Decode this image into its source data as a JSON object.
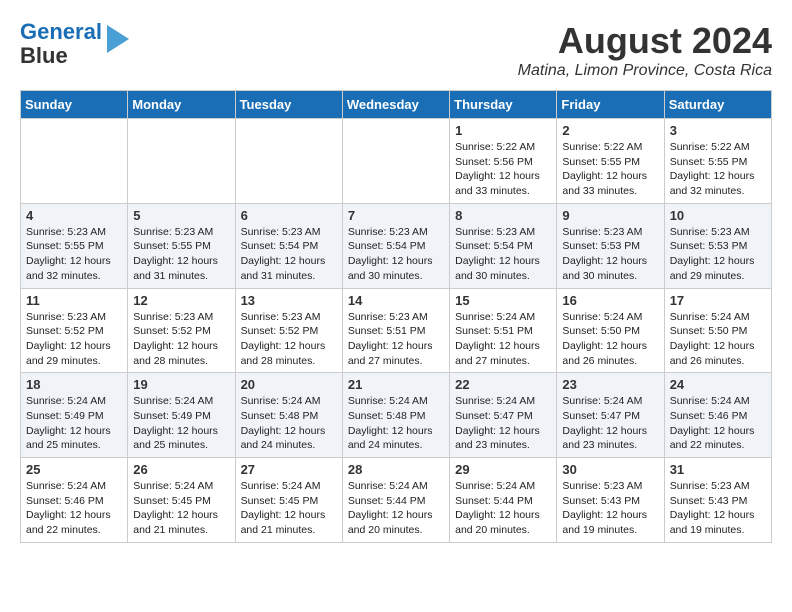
{
  "header": {
    "logo_line1": "General",
    "logo_line2": "Blue",
    "month_year": "August 2024",
    "location": "Matina, Limon Province, Costa Rica"
  },
  "weekdays": [
    "Sunday",
    "Monday",
    "Tuesday",
    "Wednesday",
    "Thursday",
    "Friday",
    "Saturday"
  ],
  "weeks": [
    [
      {
        "day": "",
        "text": ""
      },
      {
        "day": "",
        "text": ""
      },
      {
        "day": "",
        "text": ""
      },
      {
        "day": "",
        "text": ""
      },
      {
        "day": "1",
        "text": "Sunrise: 5:22 AM\nSunset: 5:56 PM\nDaylight: 12 hours\nand 33 minutes."
      },
      {
        "day": "2",
        "text": "Sunrise: 5:22 AM\nSunset: 5:55 PM\nDaylight: 12 hours\nand 33 minutes."
      },
      {
        "day": "3",
        "text": "Sunrise: 5:22 AM\nSunset: 5:55 PM\nDaylight: 12 hours\nand 32 minutes."
      }
    ],
    [
      {
        "day": "4",
        "text": "Sunrise: 5:23 AM\nSunset: 5:55 PM\nDaylight: 12 hours\nand 32 minutes."
      },
      {
        "day": "5",
        "text": "Sunrise: 5:23 AM\nSunset: 5:55 PM\nDaylight: 12 hours\nand 31 minutes."
      },
      {
        "day": "6",
        "text": "Sunrise: 5:23 AM\nSunset: 5:54 PM\nDaylight: 12 hours\nand 31 minutes."
      },
      {
        "day": "7",
        "text": "Sunrise: 5:23 AM\nSunset: 5:54 PM\nDaylight: 12 hours\nand 30 minutes."
      },
      {
        "day": "8",
        "text": "Sunrise: 5:23 AM\nSunset: 5:54 PM\nDaylight: 12 hours\nand 30 minutes."
      },
      {
        "day": "9",
        "text": "Sunrise: 5:23 AM\nSunset: 5:53 PM\nDaylight: 12 hours\nand 30 minutes."
      },
      {
        "day": "10",
        "text": "Sunrise: 5:23 AM\nSunset: 5:53 PM\nDaylight: 12 hours\nand 29 minutes."
      }
    ],
    [
      {
        "day": "11",
        "text": "Sunrise: 5:23 AM\nSunset: 5:52 PM\nDaylight: 12 hours\nand 29 minutes."
      },
      {
        "day": "12",
        "text": "Sunrise: 5:23 AM\nSunset: 5:52 PM\nDaylight: 12 hours\nand 28 minutes."
      },
      {
        "day": "13",
        "text": "Sunrise: 5:23 AM\nSunset: 5:52 PM\nDaylight: 12 hours\nand 28 minutes."
      },
      {
        "day": "14",
        "text": "Sunrise: 5:23 AM\nSunset: 5:51 PM\nDaylight: 12 hours\nand 27 minutes."
      },
      {
        "day": "15",
        "text": "Sunrise: 5:24 AM\nSunset: 5:51 PM\nDaylight: 12 hours\nand 27 minutes."
      },
      {
        "day": "16",
        "text": "Sunrise: 5:24 AM\nSunset: 5:50 PM\nDaylight: 12 hours\nand 26 minutes."
      },
      {
        "day": "17",
        "text": "Sunrise: 5:24 AM\nSunset: 5:50 PM\nDaylight: 12 hours\nand 26 minutes."
      }
    ],
    [
      {
        "day": "18",
        "text": "Sunrise: 5:24 AM\nSunset: 5:49 PM\nDaylight: 12 hours\nand 25 minutes."
      },
      {
        "day": "19",
        "text": "Sunrise: 5:24 AM\nSunset: 5:49 PM\nDaylight: 12 hours\nand 25 minutes."
      },
      {
        "day": "20",
        "text": "Sunrise: 5:24 AM\nSunset: 5:48 PM\nDaylight: 12 hours\nand 24 minutes."
      },
      {
        "day": "21",
        "text": "Sunrise: 5:24 AM\nSunset: 5:48 PM\nDaylight: 12 hours\nand 24 minutes."
      },
      {
        "day": "22",
        "text": "Sunrise: 5:24 AM\nSunset: 5:47 PM\nDaylight: 12 hours\nand 23 minutes."
      },
      {
        "day": "23",
        "text": "Sunrise: 5:24 AM\nSunset: 5:47 PM\nDaylight: 12 hours\nand 23 minutes."
      },
      {
        "day": "24",
        "text": "Sunrise: 5:24 AM\nSunset: 5:46 PM\nDaylight: 12 hours\nand 22 minutes."
      }
    ],
    [
      {
        "day": "25",
        "text": "Sunrise: 5:24 AM\nSunset: 5:46 PM\nDaylight: 12 hours\nand 22 minutes."
      },
      {
        "day": "26",
        "text": "Sunrise: 5:24 AM\nSunset: 5:45 PM\nDaylight: 12 hours\nand 21 minutes."
      },
      {
        "day": "27",
        "text": "Sunrise: 5:24 AM\nSunset: 5:45 PM\nDaylight: 12 hours\nand 21 minutes."
      },
      {
        "day": "28",
        "text": "Sunrise: 5:24 AM\nSunset: 5:44 PM\nDaylight: 12 hours\nand 20 minutes."
      },
      {
        "day": "29",
        "text": "Sunrise: 5:24 AM\nSunset: 5:44 PM\nDaylight: 12 hours\nand 20 minutes."
      },
      {
        "day": "30",
        "text": "Sunrise: 5:23 AM\nSunset: 5:43 PM\nDaylight: 12 hours\nand 19 minutes."
      },
      {
        "day": "31",
        "text": "Sunrise: 5:23 AM\nSunset: 5:43 PM\nDaylight: 12 hours\nand 19 minutes."
      }
    ]
  ]
}
